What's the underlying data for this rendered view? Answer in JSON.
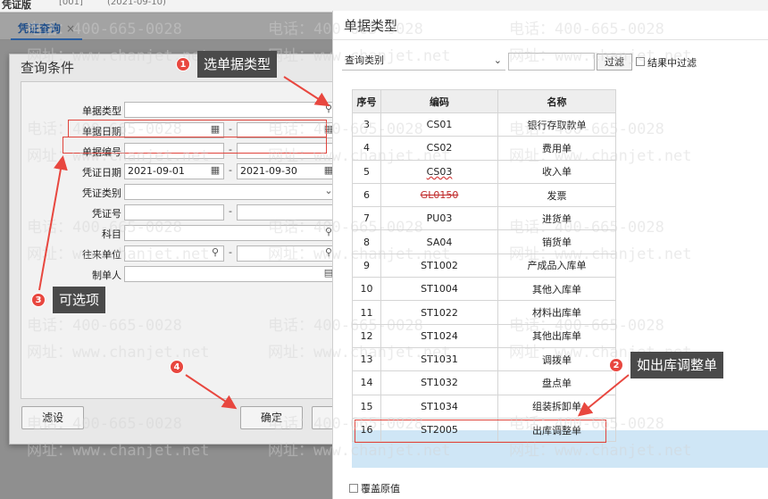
{
  "topbar": {
    "title": "凭证版",
    "part1": "[001]",
    "part2": "(2021-09-10)"
  },
  "tab": {
    "label": "凭证查询",
    "close": "×"
  },
  "query_dialog": {
    "title": "查询条件",
    "fields": {
      "doc_type": "单据类型",
      "doc_date": "单据日期",
      "doc_no": "单据编号",
      "voucher_date": "凭证日期",
      "voucher_type": "凭证类别",
      "voucher_no": "凭证号",
      "subject": "科目",
      "partner": "往来单位",
      "maker": "制单人"
    },
    "voucher_date_from": "2021-09-01",
    "voucher_date_to": "2021-09-30",
    "dash": "-",
    "buttons": {
      "filter_settings": "滤设",
      "ok": "确定"
    }
  },
  "doc_dialog": {
    "title": "单据类型",
    "query_category": "查询类别",
    "filter_button": "过滤",
    "filter_in_result": "结果中过滤",
    "columns": [
      "序号",
      "编码",
      "名称"
    ],
    "rows": [
      {
        "no": "3",
        "code": "CS01",
        "name": "银行存取款单"
      },
      {
        "no": "4",
        "code": "CS02",
        "name": "费用单"
      },
      {
        "no": "5",
        "code": "CS03",
        "name": "收入单"
      },
      {
        "no": "6",
        "code": "GL0150",
        "name": "发票"
      },
      {
        "no": "7",
        "code": "PU03",
        "name": "进货单"
      },
      {
        "no": "8",
        "code": "SA04",
        "name": "销货单"
      },
      {
        "no": "9",
        "code": "ST1002",
        "name": "产成品入库单"
      },
      {
        "no": "10",
        "code": "ST1004",
        "name": "其他入库单"
      },
      {
        "no": "11",
        "code": "ST1022",
        "name": "材料出库单"
      },
      {
        "no": "12",
        "code": "ST1024",
        "name": "其他出库单"
      },
      {
        "no": "13",
        "code": "ST1031",
        "name": "调拨单"
      },
      {
        "no": "14",
        "code": "ST1032",
        "name": "盘点单"
      },
      {
        "no": "15",
        "code": "ST1034",
        "name": "组装拆卸单"
      },
      {
        "no": "16",
        "code": "ST2005",
        "name": "出库调整单"
      }
    ],
    "overwrite_label": "覆盖原值"
  },
  "annotations": {
    "step1": {
      "num": "1",
      "text": "选单据类型"
    },
    "step2": {
      "num": "2",
      "text": "如出库调整单"
    },
    "step3": {
      "num": "3",
      "text": "可选项"
    },
    "step4": {
      "num": "4"
    }
  },
  "watermark": {
    "phone": "电话：400-665-0028",
    "site": "网址：www.chanjet.net"
  },
  "colors": {
    "annotation_red": "#e8473f",
    "tip_bg": "#4a4a4a",
    "highlight_blue": "#cfe6f6"
  }
}
